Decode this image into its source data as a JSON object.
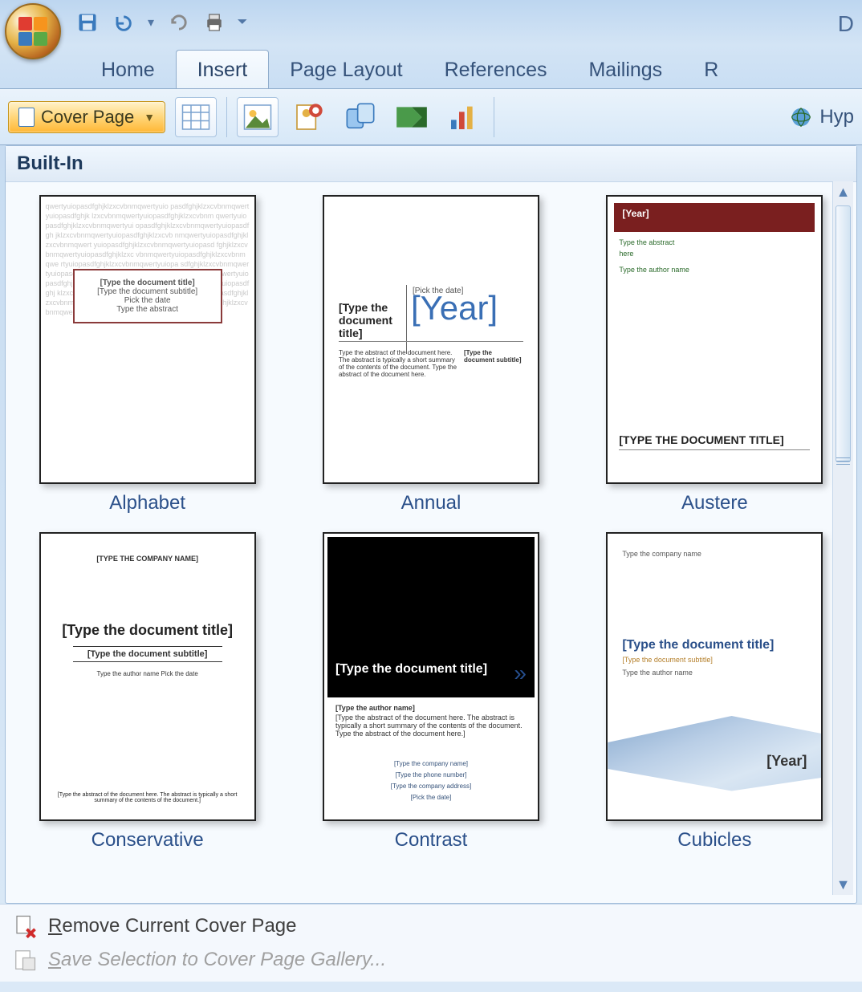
{
  "title_fragment": "D",
  "ribbon": {
    "tabs": [
      "Home",
      "Insert",
      "Page Layout",
      "References",
      "Mailings",
      "R"
    ],
    "active_tab": "Insert",
    "cover_page_label": "Cover Page",
    "hyperlink_fragment": "Hyp"
  },
  "gallery": {
    "header": "Built-In",
    "items": [
      {
        "name": "Alphabet",
        "box_title": "[Type the document title]",
        "box_sub": "[Type the document subtitle]",
        "box_meta1": "Pick the date",
        "box_meta2": "Type the abstract"
      },
      {
        "name": "Annual",
        "left_title": "[Type the document title]",
        "date_label": "[Pick the date]",
        "year": "[Year]",
        "lower_left": "Type the abstract of the document here. The abstract is typically a short summary of the contents of the document. Type the abstract of the document here.",
        "lower_right": "[Type the document subtitle]"
      },
      {
        "name": "Austere",
        "bar": "[Year]",
        "green1": "Type the abstract",
        "green2": "here",
        "green3": "Type the author name",
        "title": "[TYPE THE DOCUMENT TITLE]"
      },
      {
        "name": "Conservative",
        "top": "[TYPE THE COMPANY NAME]",
        "title": "[Type the document title]",
        "sub": "[Type the document subtitle]",
        "meta": "Type the author name\nPick the date",
        "foot": "[Type the abstract of the document here. The abstract is typically a short summary of the contents of the document.]"
      },
      {
        "name": "Contrast",
        "title": "[Type the document title]",
        "mid_head": "[Type the author name]",
        "mid_body": "[Type the abstract of the document here. The abstract is typically a short summary of the contents of the document. Type the abstract of the document here.]",
        "low1": "[Type the company name]",
        "low2": "[Type the phone number]",
        "low3": "[Type the company address]",
        "low4": "[Pick the date]"
      },
      {
        "name": "Cubicles",
        "top": "Type the company name",
        "title": "[Type the document title]",
        "sub": "[Type the document subtitle]",
        "meta": "Type the author name",
        "year": "[Year]"
      }
    ]
  },
  "footer": {
    "remove": "Remove Current Cover Page",
    "save": "Save Selection to Cover Page Gallery..."
  }
}
